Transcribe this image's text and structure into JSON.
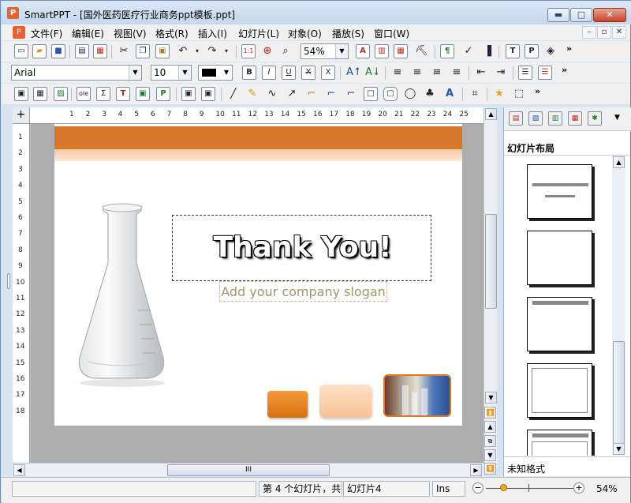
{
  "window": {
    "title": "SmartPPT - [国外医药医疗行业商务ppt模板.ppt]",
    "app_icon_letter": "P",
    "min_glyph": "▬",
    "max_glyph": "□",
    "close_glyph": "✕"
  },
  "menu": {
    "items": [
      "文件(F)",
      "编辑(E)",
      "视图(V)",
      "格式(R)",
      "插入(I)",
      "幻灯片(L)",
      "对象(O)",
      "播放(S)",
      "窗口(W)"
    ],
    "mdi_min": "–",
    "mdi_restore": "▫",
    "mdi_close": "✕"
  },
  "toolbar": {
    "zoom_value": "54%",
    "font_name": "Arial",
    "font_size": "10",
    "more_glyph": "»",
    "combo_arrow": "▼"
  },
  "ruler": {
    "horizontal_ticks": [
      "1",
      "2",
      "3",
      "4",
      "5",
      "6",
      "7",
      "8",
      "9",
      "10",
      "11",
      "12",
      "13",
      "14",
      "15",
      "16",
      "17",
      "18",
      "19",
      "20",
      "21",
      "22",
      "23",
      "24",
      "25"
    ],
    "vertical_ticks": [
      "1",
      "2",
      "3",
      "4",
      "5",
      "6",
      "7",
      "8",
      "9",
      "10",
      "11",
      "12",
      "13",
      "14",
      "15",
      "16",
      "17",
      "18"
    ],
    "corner_glyph": "+"
  },
  "slide": {
    "title": "Thank You!",
    "slogan": "Add your company slogan"
  },
  "panel": {
    "title": "幻灯片布局",
    "status": "未知格式"
  },
  "status": {
    "slide_info": "第 4 个幻灯片，共",
    "slide_name": "幻灯片4",
    "mode": "Ins",
    "zoom": "54%",
    "zoom_fraction": 0.2
  },
  "colors": {
    "accent_orange": "#d8762a",
    "titlebar": "#c4d7ed",
    "font_color": "#000000"
  }
}
